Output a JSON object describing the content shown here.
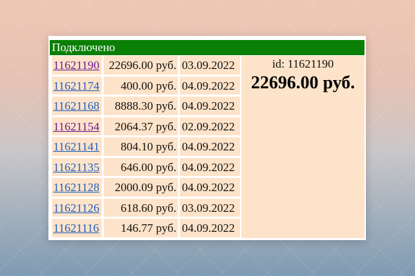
{
  "status": {
    "text": "Подключено",
    "color": "#0a7f05"
  },
  "payments": [
    {
      "id": "11621190",
      "amount": "22696.00 руб.",
      "date": "03.09.2022",
      "visited": true
    },
    {
      "id": "11621174",
      "amount": "400.00 руб.",
      "date": "04.09.2022",
      "visited": false
    },
    {
      "id": "11621168",
      "amount": "8888.30 руб.",
      "date": "04.09.2022",
      "visited": false
    },
    {
      "id": "11621154",
      "amount": "2064.37 руб.",
      "date": "02.09.2022",
      "visited": true
    },
    {
      "id": "11621141",
      "amount": "804.10 руб.",
      "date": "04.09.2022",
      "visited": false
    },
    {
      "id": "11621135",
      "amount": "646.00 руб.",
      "date": "04.09.2022",
      "visited": false
    },
    {
      "id": "11621128",
      "amount": "2000.09 руб.",
      "date": "04.09.2022",
      "visited": false
    },
    {
      "id": "11621126",
      "amount": "618.60 руб.",
      "date": "03.09.2022",
      "visited": false
    },
    {
      "id": "11621116",
      "amount": "146.77 руб.",
      "date": "04.09.2022",
      "visited": false
    }
  ],
  "detail": {
    "id_label": "id: 11621190",
    "amount": "22696.00 руб."
  },
  "colors": {
    "cell_bg": "#fde3c9",
    "link": "#1f5fbf",
    "visited_link": "#6a1a8f"
  }
}
